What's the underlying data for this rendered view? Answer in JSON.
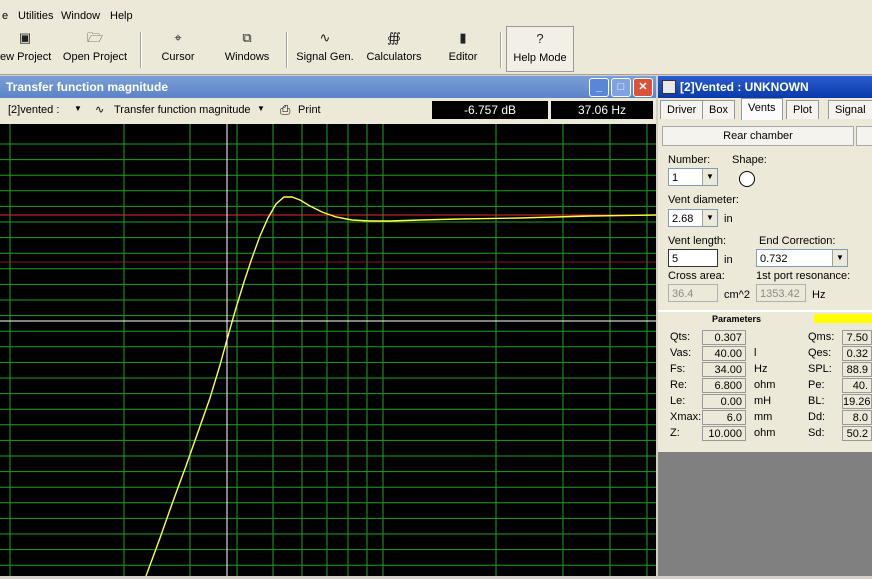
{
  "menu": [
    "e",
    "Utilities",
    "Window",
    "Help"
  ],
  "toolbar": {
    "new_project": "ew Project",
    "open_project": "Open Project",
    "cursor": "Cursor",
    "windows": "Windows",
    "signal_gen": "Signal Gen.",
    "calculators": "Calculators",
    "editor": "Editor",
    "help_mode": "Help Mode"
  },
  "tf_window": {
    "title": "Transfer function magnitude",
    "project_select": "[2]vented :",
    "plot_select": "Transfer function magnitude",
    "print_label": "Print",
    "readout_db": "-6.757 dB",
    "readout_hz": "37.06 Hz"
  },
  "vent_window": {
    "title": "[2]Vented : UNKNOWN",
    "tabs": [
      "Driver",
      "Box",
      "Vents",
      "Plot",
      "Signal"
    ],
    "active_tab": "Vents",
    "section_button": "Rear chamber",
    "number_label": "Number:",
    "number_value": "1",
    "shape_label": "Shape:",
    "vent_diameter_label": "Vent diameter:",
    "vent_diameter_value": "2.68",
    "vent_diameter_unit": "in",
    "vent_length_label": "Vent length:",
    "vent_length_value": "5",
    "vent_length_unit": "in",
    "end_correction_label": "End Correction:",
    "end_correction_value": "0.732",
    "cross_area_label": "Cross area:",
    "cross_area_value": "36.4",
    "cross_area_unit": "cm^2",
    "port_res_label": "1st port resonance:",
    "port_res_value": "1353.42",
    "port_res_unit": "Hz"
  },
  "parameters": {
    "header": "Parameters",
    "left": [
      {
        "label": "Qts:",
        "value": "0.307",
        "unit": ""
      },
      {
        "label": "Vas:",
        "value": "40.00",
        "unit": "l"
      },
      {
        "label": "Fs:",
        "value": "34.00",
        "unit": "Hz"
      },
      {
        "label": "Re:",
        "value": "6.800",
        "unit": "ohm"
      },
      {
        "label": "Le:",
        "value": "0.00",
        "unit": "mH"
      },
      {
        "label": "Xmax:",
        "value": "6.0",
        "unit": "mm"
      },
      {
        "label": "Z:",
        "value": "10.000",
        "unit": "ohm"
      }
    ],
    "right": [
      {
        "label": "Qms:",
        "value": "7.50"
      },
      {
        "label": "Qes:",
        "value": "0.32"
      },
      {
        "label": "SPL:",
        "value": "88.9"
      },
      {
        "label": "Pe:",
        "value": "40."
      },
      {
        "label": "BL:",
        "value": "19.26"
      },
      {
        "label": "Dd:",
        "value": "8.0"
      },
      {
        "label": "Sd:",
        "value": "50.2"
      }
    ]
  },
  "colors": {
    "grid": "#1fa01f",
    "curve": "#ffff40",
    "reference_line": "#e03030",
    "cursor": "#ffffff"
  }
}
